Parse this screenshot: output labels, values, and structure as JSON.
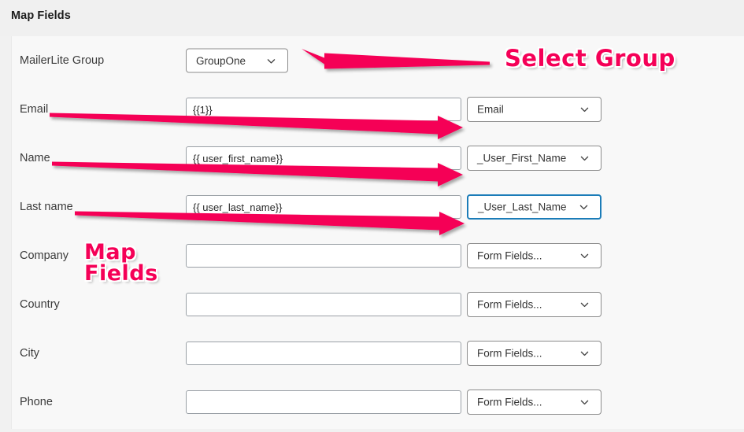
{
  "header": {
    "title": "Map Fields"
  },
  "colors": {
    "annotation": "#f50057",
    "focus_border": "#1b7cb8",
    "panel_bg": "#f8f8f8",
    "header_bg": "#f0f0f0"
  },
  "form": {
    "rows": [
      {
        "label": "MailerLite Group",
        "control": "group-select",
        "select_value": "GroupOne",
        "focused": false
      },
      {
        "label": "Email",
        "control": "input-select",
        "input_value": "{{1}}",
        "input_placeholder": "",
        "select_value": "Email",
        "focused": false
      },
      {
        "label": "Name",
        "control": "input-select",
        "input_value": "{{ user_first_name}}",
        "input_placeholder": "",
        "select_value": "_User_First_Name",
        "focused": false
      },
      {
        "label": "Last name",
        "control": "input-select",
        "input_value": "{{ user_last_name}}",
        "input_placeholder": "",
        "select_value": "_User_Last_Name",
        "focused": true
      },
      {
        "label": "Company",
        "control": "input-select",
        "input_value": "",
        "input_placeholder": "",
        "select_value": "Form Fields...",
        "focused": false
      },
      {
        "label": "Country",
        "control": "input-select",
        "input_value": "",
        "input_placeholder": "",
        "select_value": "Form Fields...",
        "focused": false
      },
      {
        "label": "City",
        "control": "input-select",
        "input_value": "",
        "input_placeholder": "",
        "select_value": "Form Fields...",
        "focused": false
      },
      {
        "label": "Phone",
        "control": "input-select",
        "input_value": "",
        "input_placeholder": "",
        "select_value": "Form Fields...",
        "focused": false
      }
    ]
  },
  "annotations": {
    "select_group": "Select Group",
    "map_fields": "Map\nFields"
  }
}
